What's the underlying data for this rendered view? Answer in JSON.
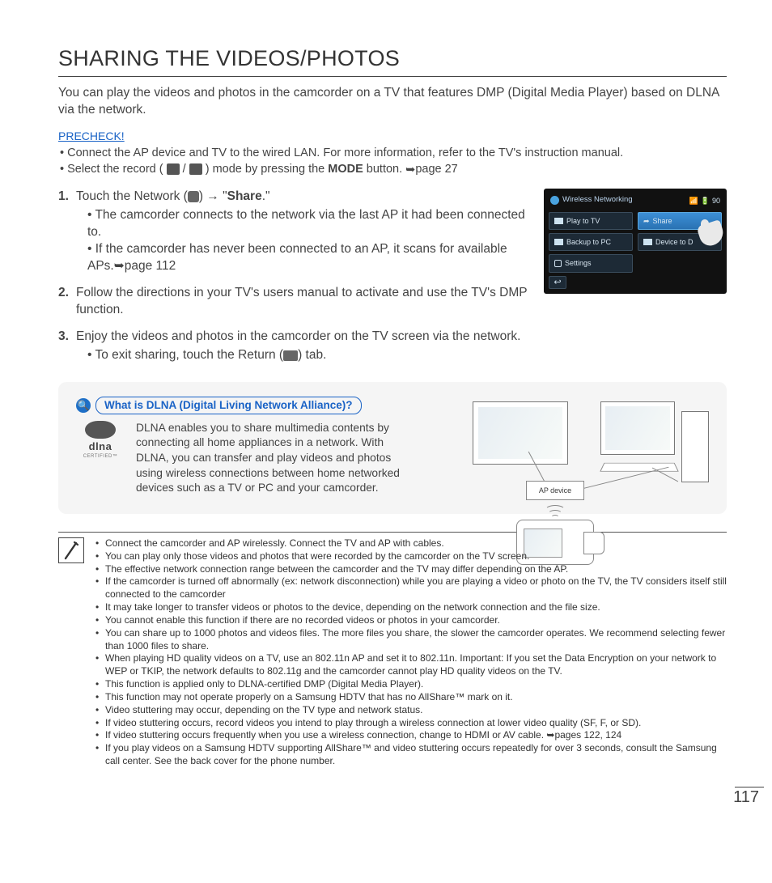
{
  "title": "SHARING THE VIDEOS/PHOTOS",
  "intro": "You can play the videos and photos in the camcorder on a TV that features DMP (Digital Media Player) based on DLNA via the network.",
  "precheck": {
    "label": "PRECHECK!",
    "items": [
      "Connect the AP device and TV to the wired LAN. For more information, refer to the TV's instruction manual.",
      "Select the record ( 🎥 / 📷 ) mode by pressing the MODE button. ➥page 27"
    ]
  },
  "steps": {
    "s1": {
      "num": "1.",
      "pre": "Touch the Network (",
      "post": ") → \"",
      "share": "Share",
      "end": ".\"",
      "sub": [
        "The camcorder connects to the network via the last AP it had been connected to.",
        "If the camcorder has never been connected to an AP, it scans for available APs.➥page 112"
      ]
    },
    "s2": {
      "num": "2.",
      "text": "Follow the directions in your TV's users manual to activate and use the TV's DMP function."
    },
    "s3": {
      "num": "3.",
      "text": "Enjoy the videos and photos in the camcorder on the TV screen via the network.",
      "sub_pre": "To exit sharing, touch the Return (",
      "sub_post": ") tab."
    }
  },
  "screen": {
    "title": "Wireless Networking",
    "battery": "90",
    "items": {
      "play": "Play to TV",
      "share": "Share",
      "backup": "Backup to PC",
      "d2d": "Device to D",
      "settings": "Settings"
    }
  },
  "dlna": {
    "question": "What is DLNA (Digital Living Network Alliance)?",
    "logo": "dlna",
    "logo_sub": "CERTIFIED™",
    "desc": "DLNA enables you to share multimedia contents by connecting all home appliances in a network. With DLNA, you can transfer and play videos and photos using wireless connections between home networked devices such as a TV or PC and your camcorder.",
    "ap_label": "AP device"
  },
  "notes": [
    "Connect the camcorder and AP wirelessly. Connect the TV and AP with cables.",
    "You can play only those videos and photos that were recorded by the camcorder on the TV screen.",
    "The effective network connection range between the camcorder and the TV may differ depending on the AP.",
    "If the camcorder is turned off abnormally (ex: network disconnection) while you are playing a video or photo on the TV, the TV considers itself still connected to the camcorder",
    "It may take longer to transfer videos or photos to the device, depending on the network connection and the file size.",
    "You cannot enable this function if there are no recorded videos or photos in your camcorder.",
    "You can share up to 1000 photos and videos files. The more files you share, the slower the camcorder operates. We recommend selecting fewer than 1000 files to share.",
    "When playing HD quality videos on a TV, use an 802.11n AP and set it to 802.11n. Important: If you set the Data Encryption on your network to WEP or TKIP, the network defaults to 802.11g and the camcorder cannot play HD quality videos on the TV.",
    "This function is applied only to DLNA-certified DMP (Digital Media Player).",
    "This function may not operate properly on a Samsung HDTV that has no AllShare™ mark on it.",
    "Video stuttering may occur, depending on the TV type and network status.",
    "If video stuttering occurs, record videos you intend to play through a wireless connection at lower video quality (SF, F, or SD).",
    "If video stuttering occurs frequently when you use a wireless connection, change to HDMI or AV cable. ➥pages 122, 124",
    "If you play videos on a Samsung HDTV supporting AllShare™ and video stuttering occurs repeatedly for over 3 seconds, consult the Samsung call center. See the back cover for the phone number."
  ],
  "page_number": "117"
}
